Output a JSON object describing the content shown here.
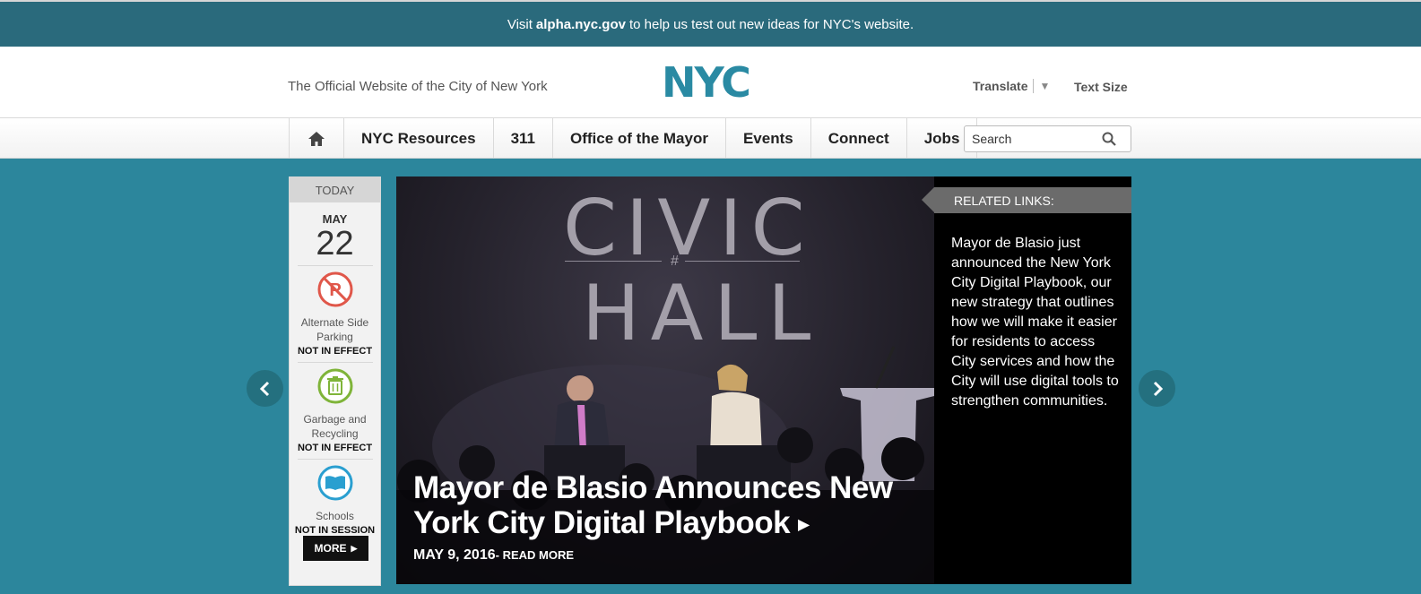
{
  "banner": {
    "prefix": "Visit ",
    "link": "alpha.nyc.gov",
    "suffix": " to help us test out new ideas for NYC's website."
  },
  "header": {
    "tagline": "The Official Website of the City of New York",
    "logo_text": "NYC",
    "translate_label": "Translate",
    "text_size_label": "Text Size",
    "brand_color": "#2a8aa3"
  },
  "nav": {
    "items": [
      {
        "label": "NYC Resources"
      },
      {
        "label": "311"
      },
      {
        "label": "Office of the Mayor"
      },
      {
        "label": "Events"
      },
      {
        "label": "Connect"
      },
      {
        "label": "Jobs"
      }
    ],
    "search_placeholder": "Search"
  },
  "today": {
    "header": "TODAY",
    "month": "MAY",
    "day": "22",
    "services": [
      {
        "label_line1": "Alternate Side",
        "label_line2": "Parking",
        "status": "NOT IN EFFECT",
        "icon": "no-parking-icon",
        "color": "#e0574a"
      },
      {
        "label_line1": "Garbage and",
        "label_line2": "Recycling",
        "status": "NOT IN EFFECT",
        "icon": "trash-icon",
        "color": "#7fb439"
      },
      {
        "label_line1": "Schools",
        "label_line2": "",
        "status": "NOT IN SESSION",
        "icon": "book-icon",
        "color": "#2a9fd0"
      }
    ],
    "more_label": "MORE"
  },
  "hero": {
    "sign_top": "CIVIC",
    "sign_mid": "#",
    "sign_bottom": "HALL",
    "headline": "Mayor de Blasio Announces New York City Digital Playbook",
    "date": "MAY 9, 2016",
    "read_more": "- READ MORE"
  },
  "related": {
    "header": "RELATED LINKS:",
    "text": "Mayor de Blasio just announced the New York City Digital Playbook, our new strategy that outlines how we will make it easier for residents to access City services and how the City will use digital tools to strengthen communities."
  }
}
